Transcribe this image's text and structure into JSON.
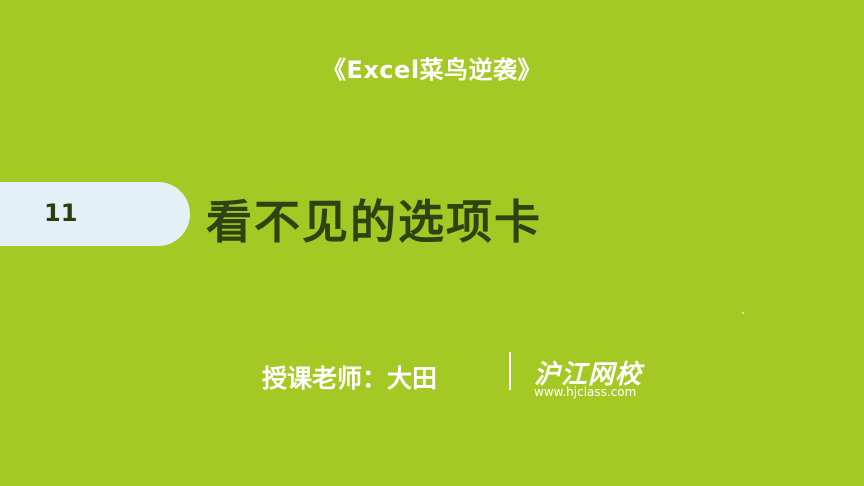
{
  "slide": {
    "series_title": "《Excel菜鸟逆袭》",
    "lesson_number": "11",
    "lesson_title": "看不见的选项卡",
    "teacher": "授课老师：大田",
    "brand_name": "沪江网校",
    "brand_url": "www.hjclass.com"
  },
  "colors": {
    "background": "#a5c924",
    "tab": "#e3f0f6",
    "title_text": "#2e4212",
    "light_text": "#ffffff"
  }
}
